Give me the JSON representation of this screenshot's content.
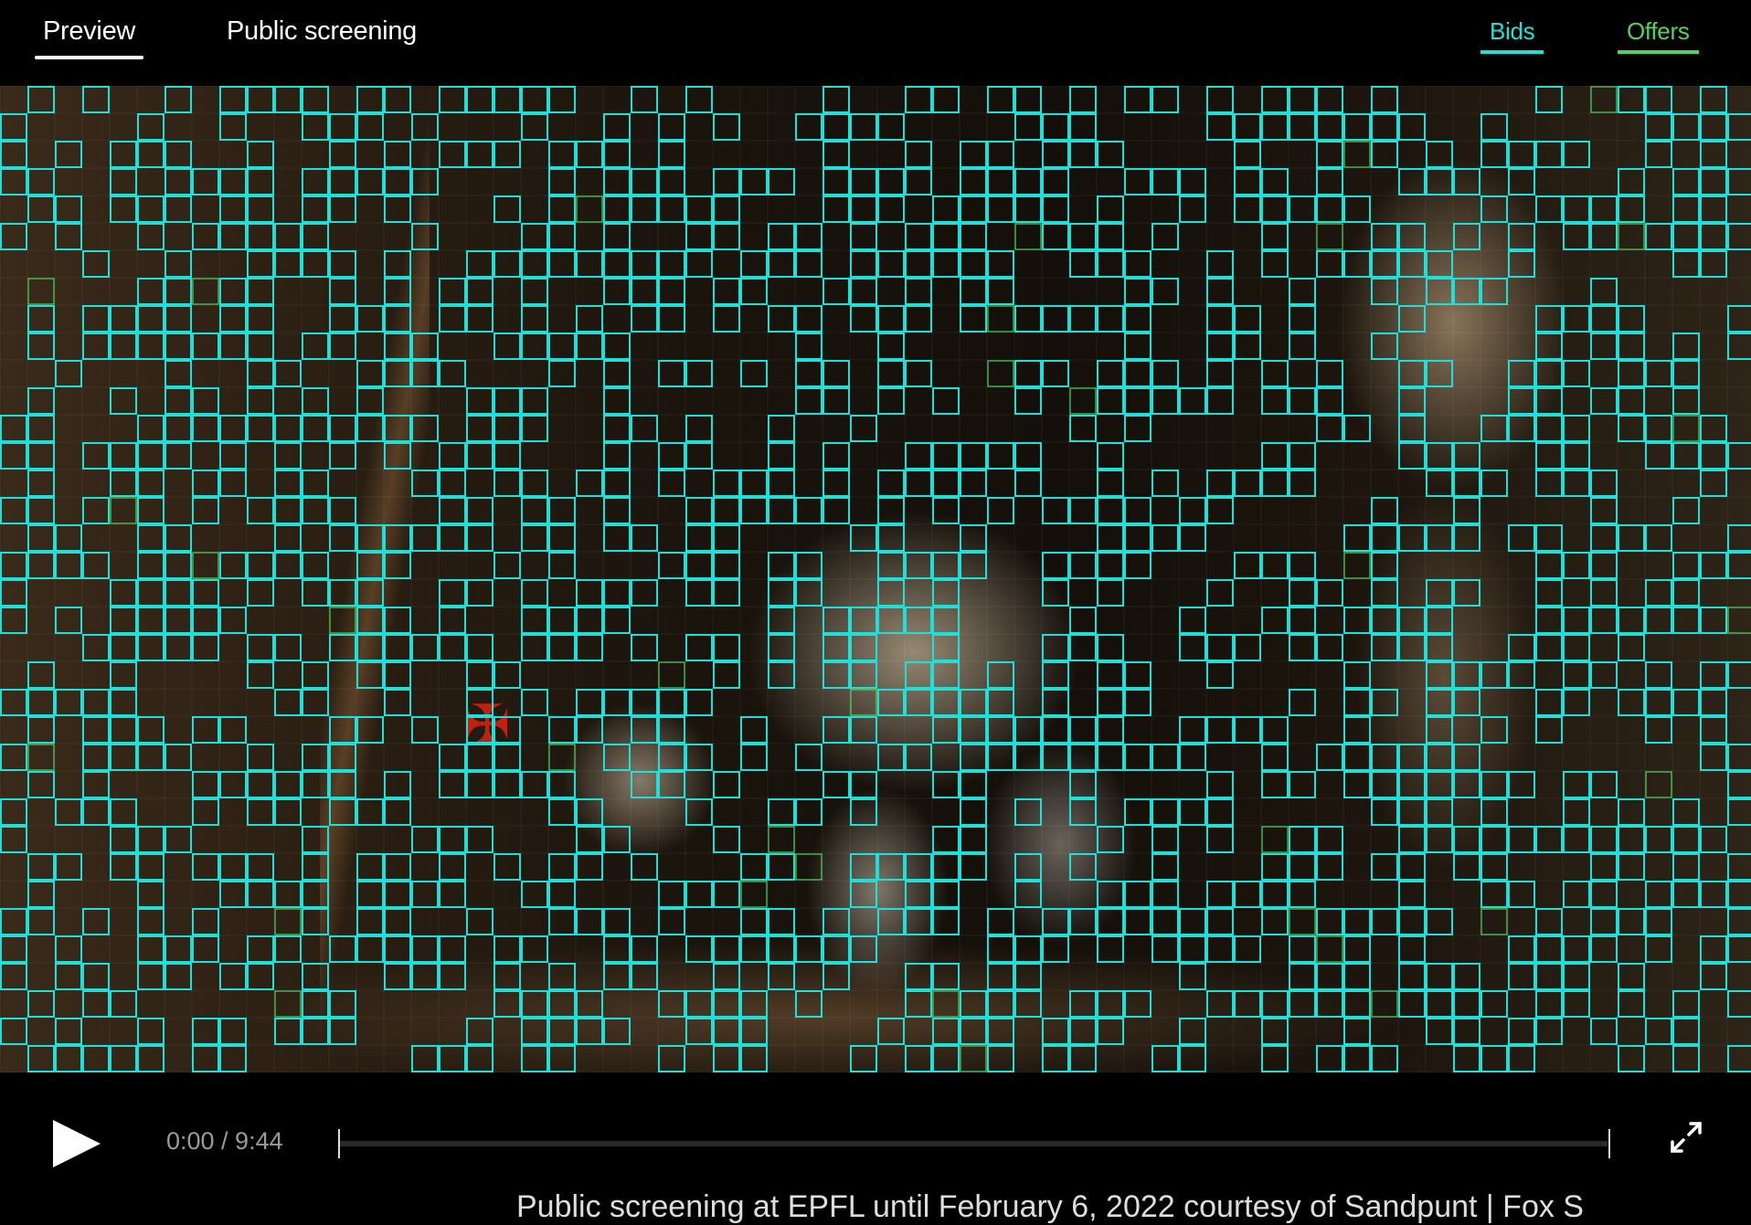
{
  "nav": {
    "tabs": [
      {
        "label": "Preview",
        "active": true
      },
      {
        "label": "Public screening",
        "active": false
      },
      {
        "label": "Bids",
        "color": "#1fe0d8"
      },
      {
        "label": "Offers",
        "color": "#4fd460"
      }
    ]
  },
  "player": {
    "time": "0:00 / 9:44",
    "progress": 0
  },
  "caption": "Public screening at EPFL until February 6, 2022 courtesy of Sandpunt | Fox S",
  "colors": {
    "bid_cell": "#1fe0d8",
    "offer_cell": "#4fd460",
    "background": "#000000"
  },
  "icons": [
    "play-icon",
    "fullscreen-icon"
  ]
}
